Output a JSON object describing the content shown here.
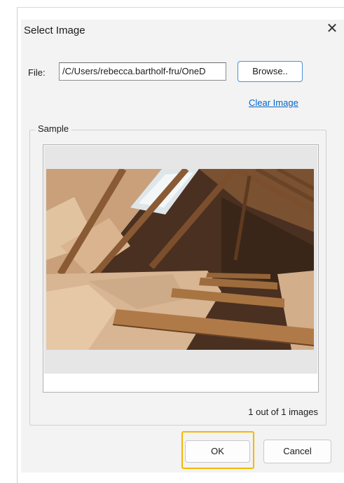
{
  "dialog": {
    "title": "Select Image",
    "close_icon": "close-icon"
  },
  "file": {
    "label": "File:",
    "value": "/C/Users/rebecca.bartholf-fru/OneD",
    "browse_label": "Browse..",
    "clear_label": "Clear Image"
  },
  "sample": {
    "label": "Sample",
    "image_description": "attic-insulation-photo",
    "count_text": "1 out of 1 images"
  },
  "buttons": {
    "ok": "OK",
    "cancel": "Cancel"
  },
  "colors": {
    "dialog_bg": "#f3f3f3",
    "link": "#0066cc",
    "focus_highlight": "#f5b800",
    "browse_border": "#4a90d9"
  }
}
